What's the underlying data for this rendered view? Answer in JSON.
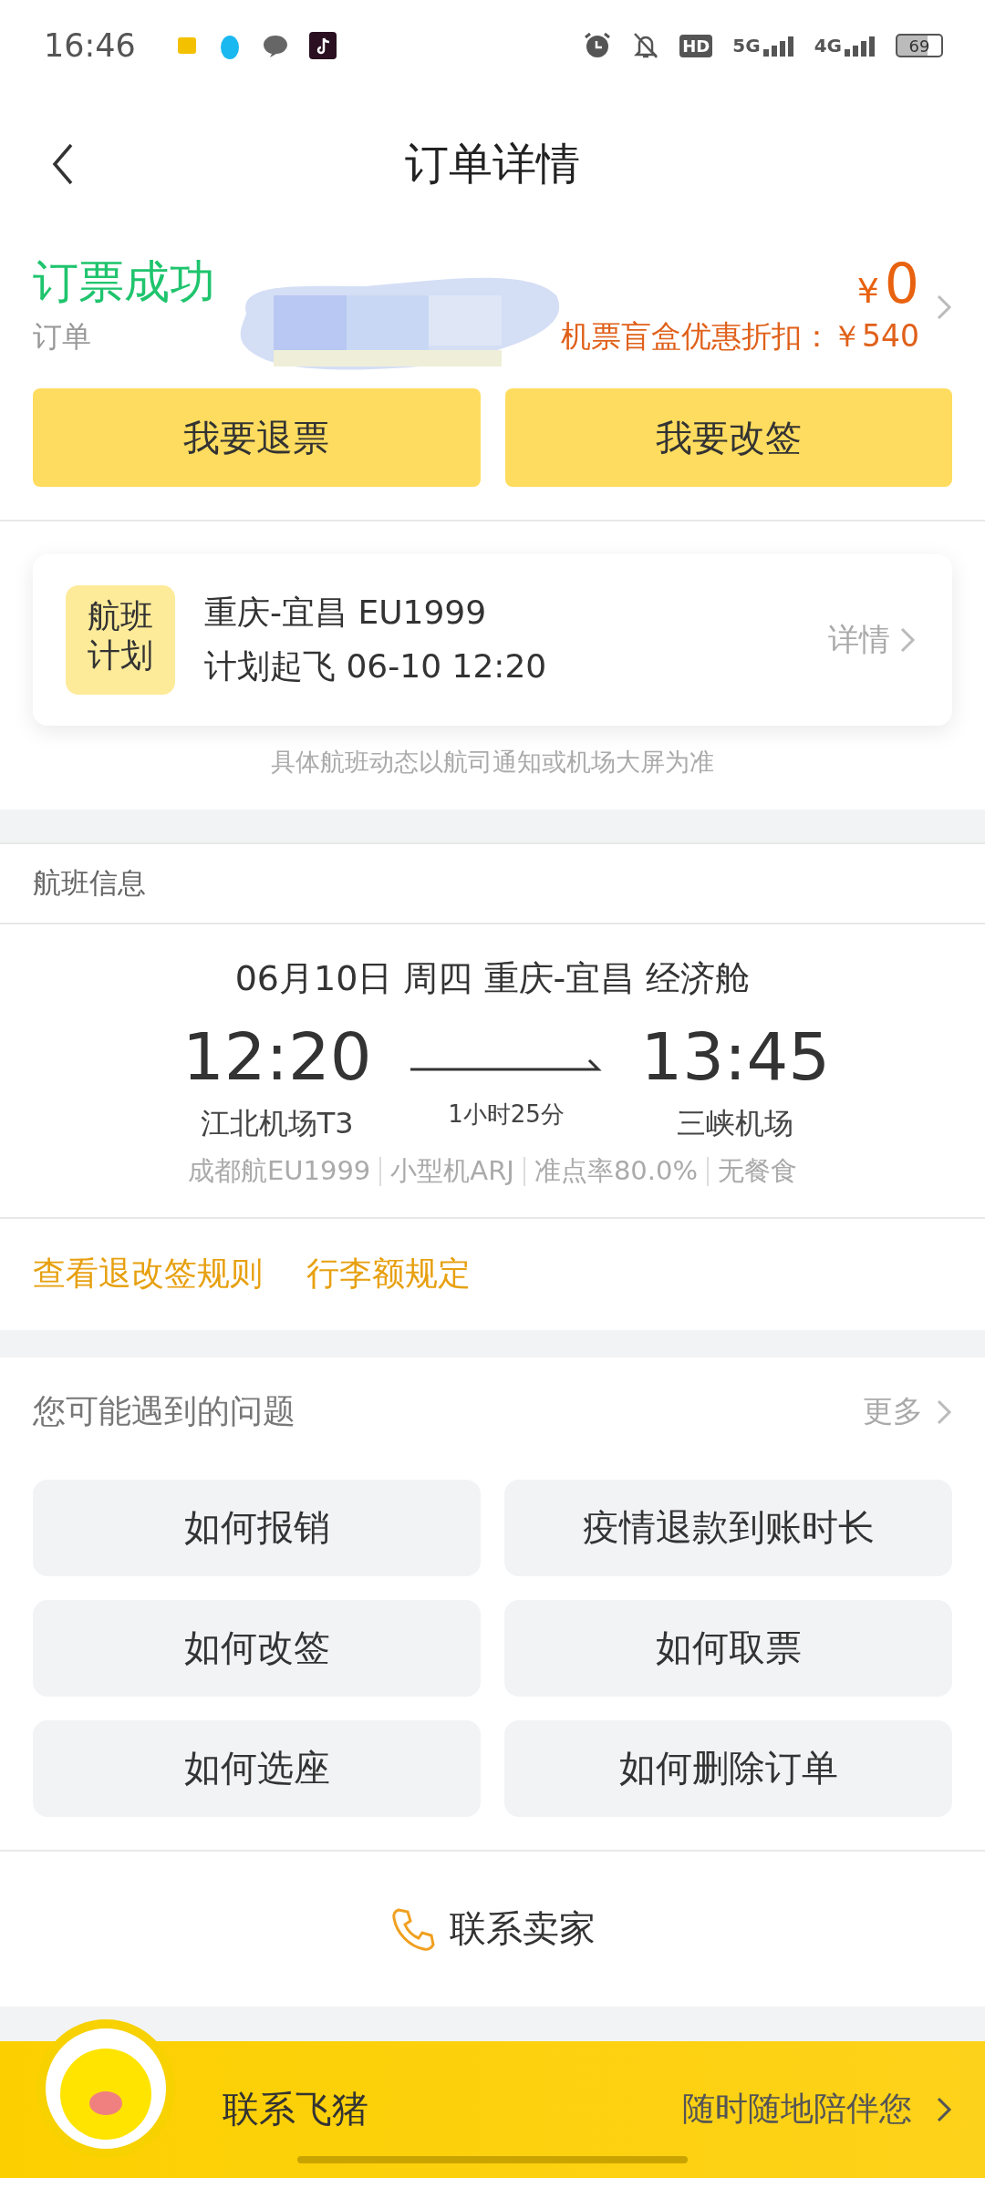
{
  "status_bar": {
    "time": "16:46",
    "indicators": [
      "HD",
      "5G",
      "4G"
    ],
    "battery": "69"
  },
  "header": {
    "title": "订单详情"
  },
  "order": {
    "status": "订票成功",
    "order_number": "订单",
    "currency": "¥",
    "price": "0",
    "discount": "机票盲盒优惠折扣：￥540",
    "actions": [
      "我要退票",
      "我要改签"
    ]
  },
  "flight_plan": {
    "badge": "航班计划",
    "route": "重庆-宜昌 EU1999",
    "departure": "计划起飞 06-10 12:20",
    "link": "详情",
    "note": "具体航班动态以航司通知或机场大屏为准"
  },
  "flight_info": {
    "heading": "航班信息",
    "summary": "06月10日 周四 重庆-宜昌 经济舱",
    "depart_time": "12:20",
    "arrive_time": "13:45",
    "depart_airport": "江北机场T3",
    "arrive_airport": "三峡机场",
    "duration": "1小时25分",
    "details": [
      "成都航EU1999",
      "小型机ARJ",
      "准点率80.0%",
      "无餐食"
    ],
    "links": [
      "查看退改签规则",
      "行李额规定"
    ]
  },
  "faq": {
    "heading": "您可能遇到的问题",
    "more": "更多",
    "questions": [
      "如何报销",
      "疫情退款到账时长",
      "如何改签",
      "如何取票",
      "如何选座",
      "如何删除订单"
    ]
  },
  "contact_seller": {
    "label": "联系卖家"
  },
  "banner": {
    "title": "联系飞猪",
    "tagline": "随时随地陪伴您"
  }
}
